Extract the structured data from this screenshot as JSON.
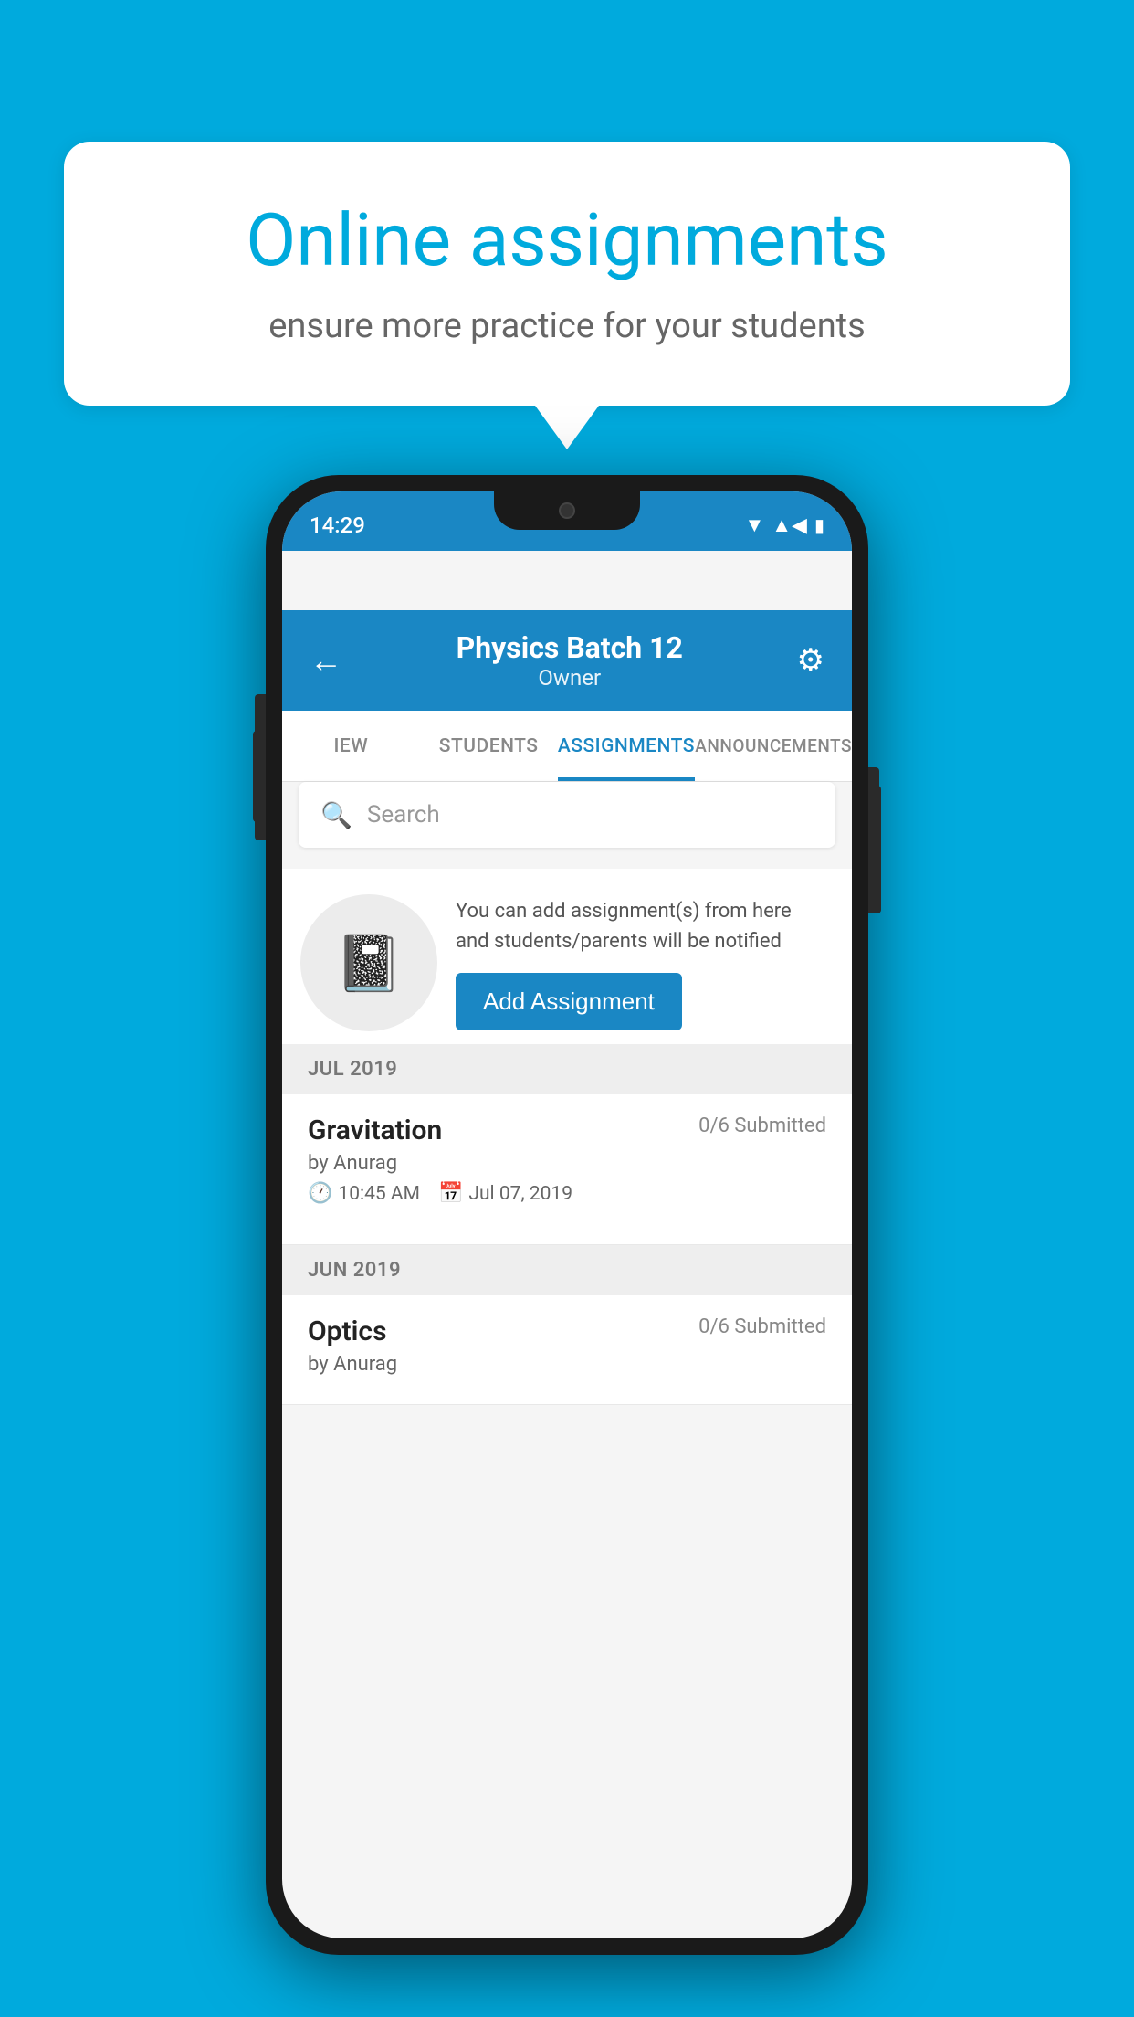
{
  "background_color": "#00AADD",
  "speech_bubble": {
    "title": "Online assignments",
    "subtitle": "ensure more practice for your students"
  },
  "phone": {
    "status_bar": {
      "time": "14:29"
    },
    "header": {
      "title": "Physics Batch 12",
      "subtitle": "Owner",
      "back_label": "←",
      "settings_label": "⚙"
    },
    "tabs": [
      {
        "label": "IEW",
        "active": false
      },
      {
        "label": "STUDENTS",
        "active": false
      },
      {
        "label": "ASSIGNMENTS",
        "active": true
      },
      {
        "label": "ANNOUNCEMENTS",
        "active": false
      }
    ],
    "search": {
      "placeholder": "Search"
    },
    "promo": {
      "text": "You can add assignment(s) from here and students/parents will be notified",
      "button_label": "Add Assignment"
    },
    "sections": [
      {
        "label": "JUL 2019",
        "assignments": [
          {
            "name": "Gravitation",
            "submitted": "0/6 Submitted",
            "by": "by Anurag",
            "time": "10:45 AM",
            "date": "Jul 07, 2019"
          }
        ]
      },
      {
        "label": "JUN 2019",
        "assignments": [
          {
            "name": "Optics",
            "submitted": "0/6 Submitted",
            "by": "by Anurag",
            "time": "",
            "date": ""
          }
        ]
      }
    ]
  }
}
